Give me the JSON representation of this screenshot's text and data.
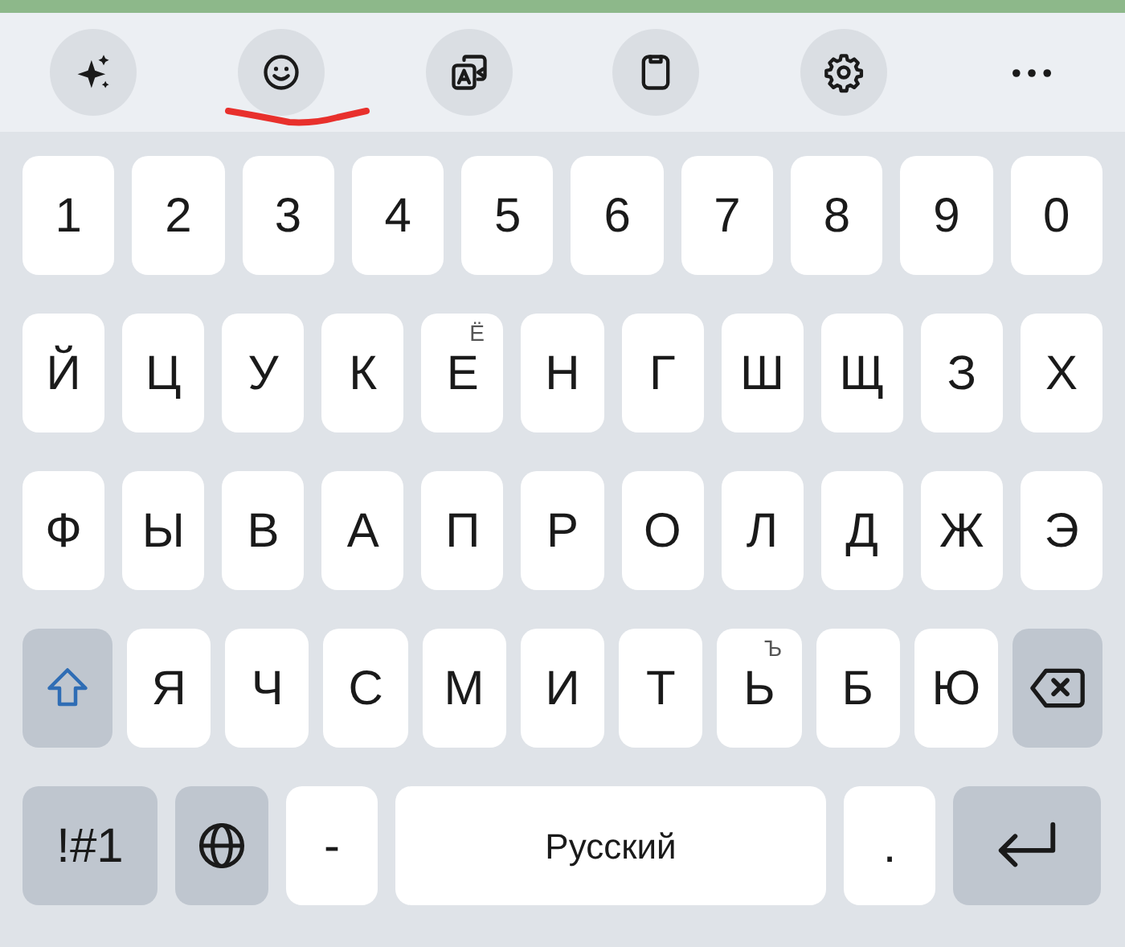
{
  "toolbar": [
    {
      "kind": "sparkle"
    },
    {
      "kind": "emoji"
    },
    {
      "kind": "translate"
    },
    {
      "kind": "clipboard"
    },
    {
      "kind": "settings"
    },
    {
      "kind": "more"
    }
  ],
  "rows": [
    [
      {
        "kind": "char",
        "label": "1"
      },
      {
        "kind": "char",
        "label": "2"
      },
      {
        "kind": "char",
        "label": "3"
      },
      {
        "kind": "char",
        "label": "4"
      },
      {
        "kind": "char",
        "label": "5"
      },
      {
        "kind": "char",
        "label": "6"
      },
      {
        "kind": "char",
        "label": "7"
      },
      {
        "kind": "char",
        "label": "8"
      },
      {
        "kind": "char",
        "label": "9"
      },
      {
        "kind": "char",
        "label": "0"
      }
    ],
    [
      {
        "kind": "char",
        "label": "Й"
      },
      {
        "kind": "char",
        "label": "Ц"
      },
      {
        "kind": "char",
        "label": "У"
      },
      {
        "kind": "char",
        "label": "К"
      },
      {
        "kind": "char",
        "label": "Е",
        "hint": "Ё"
      },
      {
        "kind": "char",
        "label": "Н"
      },
      {
        "kind": "char",
        "label": "Г"
      },
      {
        "kind": "char",
        "label": "Ш"
      },
      {
        "kind": "char",
        "label": "Щ"
      },
      {
        "kind": "char",
        "label": "З"
      },
      {
        "kind": "char",
        "label": "Х"
      }
    ],
    [
      {
        "kind": "char",
        "label": "Ф"
      },
      {
        "kind": "char",
        "label": "Ы"
      },
      {
        "kind": "char",
        "label": "В"
      },
      {
        "kind": "char",
        "label": "А"
      },
      {
        "kind": "char",
        "label": "П"
      },
      {
        "kind": "char",
        "label": "Р"
      },
      {
        "kind": "char",
        "label": "О"
      },
      {
        "kind": "char",
        "label": "Л"
      },
      {
        "kind": "char",
        "label": "Д"
      },
      {
        "kind": "char",
        "label": "Ж"
      },
      {
        "kind": "char",
        "label": "Э"
      }
    ],
    [
      {
        "kind": "shift"
      },
      {
        "kind": "char",
        "label": "Я"
      },
      {
        "kind": "char",
        "label": "Ч"
      },
      {
        "kind": "char",
        "label": "С"
      },
      {
        "kind": "char",
        "label": "М"
      },
      {
        "kind": "char",
        "label": "И"
      },
      {
        "kind": "char",
        "label": "Т"
      },
      {
        "kind": "char",
        "label": "Ь",
        "hint": "Ъ"
      },
      {
        "kind": "char",
        "label": "Б"
      },
      {
        "kind": "char",
        "label": "Ю"
      },
      {
        "kind": "backspace"
      }
    ],
    [
      {
        "kind": "symbols",
        "label": "!#1"
      },
      {
        "kind": "globe"
      },
      {
        "kind": "char",
        "label": "-"
      },
      {
        "kind": "space",
        "label": "Русский"
      },
      {
        "kind": "char",
        "label": "."
      },
      {
        "kind": "enter"
      }
    ]
  ]
}
